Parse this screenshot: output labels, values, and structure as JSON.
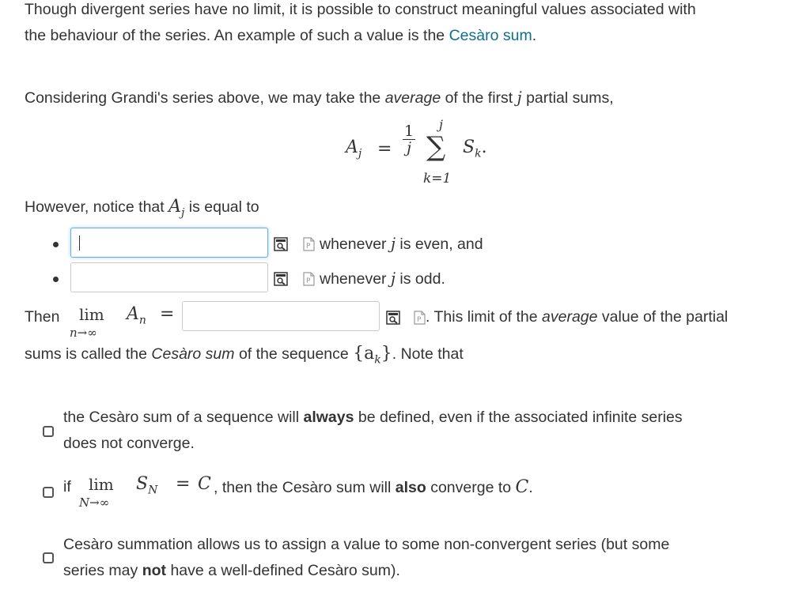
{
  "intro": {
    "line1": "Though divergent series have no limit, it is possible to construct meaningful values associated with",
    "line2_prefix": "the behaviour of the series. An example of such a value is the ",
    "link": "Cesàro sum",
    "line2_suffix": "."
  },
  "grandi": {
    "prefix": "Considering Grandi's series above, we may take the ",
    "em": "average",
    "middle": " of the first ",
    "var": "j",
    "suffix": " partial sums,"
  },
  "formula": {
    "lhs": "A",
    "lhs_sub": "j",
    "eq": "=",
    "frac_num": "1",
    "frac_den": "j",
    "sum_upper": "j",
    "sum_sign": "∑",
    "sum_lower": "k=1",
    "term": "S",
    "term_sub": "k",
    "end": "."
  },
  "however": {
    "prefix": "However, notice that ",
    "var": "A",
    "var_sub": "j",
    "suffix": " is equal to"
  },
  "bullets": [
    {
      "value": "",
      "pre": "whenever ",
      "var": "j",
      "post": " is even, and"
    },
    {
      "value": "",
      "pre": "whenever ",
      "var": "j",
      "post": " is odd."
    }
  ],
  "then": {
    "prefix": "Then",
    "lim": "lim",
    "lim_sub": "n→∞",
    "var": "A",
    "var_sub": "n",
    "eq": "=",
    "value": "",
    "after": ". This limit of the ",
    "after_em": "average",
    "after_end": " value of the partial",
    "line2_prefix": "sums is called the ",
    "line2_em": "Cesàro sum",
    "line2_mid": " of the sequence ",
    "seq": "{a",
    "seq_sub": "k",
    "seq_end": "}",
    "line2_suffix": ". Note that"
  },
  "options": [
    {
      "line1_prefix": "the Cesàro sum of a sequence will ",
      "line1_bold": "always",
      "line1_suffix": " be defined, even if the associated infinite series",
      "line2": "does not converge.",
      "checked": false
    },
    {
      "prefix": "if",
      "lim": "lim",
      "lim_sub": "N→∞",
      "var": "S",
      "var_sub": "N",
      "eq": "=",
      "c": "C",
      "mid": ", then the Cesàro sum will ",
      "bold": "also",
      "suffix": " converge to ",
      "c2": "C",
      "end": ".",
      "checked": false
    },
    {
      "line1": "Cesàro summation allows us to assign a value to some non-convergent series (but some",
      "line2_prefix": "series may ",
      "line2_bold": "not",
      "line2_suffix": " have a well-defined Cesàro sum).",
      "checked": false
    }
  ],
  "icons": [
    "preview-icon",
    "formula-palette-icon"
  ],
  "colors": {
    "link": "#0e6f8f",
    "text": "#333333",
    "focus_border": "#66afe9",
    "input_border": "#cccccc"
  }
}
